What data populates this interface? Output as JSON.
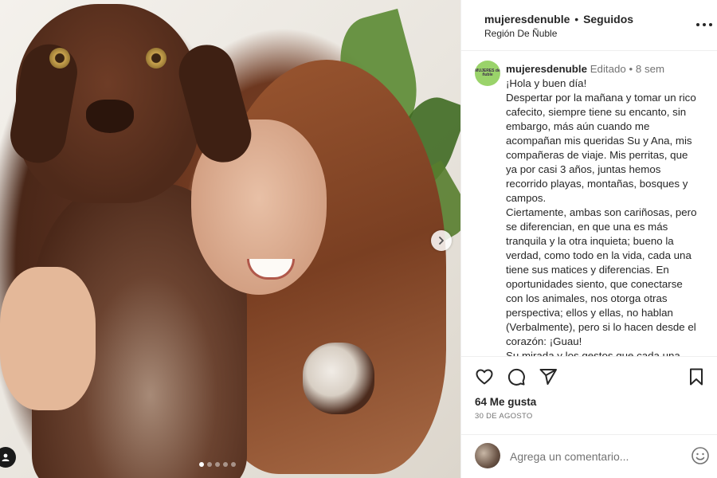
{
  "post": {
    "carousel_dots": 5,
    "carousel_active_index": 0
  },
  "header": {
    "username": "mujeresdenuble",
    "separator": "•",
    "follow_status": "Seguidos",
    "location": "Región De Ñuble"
  },
  "caption": {
    "username": "mujeresdenuble",
    "edited_label": "Editado",
    "meta_separator": "•",
    "time_ago": "8 sem",
    "avatar_text": "MUJERES de ñuble",
    "paragraphs": [
      "¡Hola y buen día!",
      "Despertar por la mañana y tomar un rico cafecito, siempre tiene su encanto, sin embargo, más aún cuando me acompañan mis queridas Su y Ana, mis compañeras de viaje. Mis perritas, que ya por casi 3 años, juntas hemos recorrido playas, montañas, bosques y campos.",
      "Ciertamente, ambas son cariñosas, pero se diferencian, en que una es más tranquila y la otra inquieta; bueno la verdad, como todo en la vida, cada una tiene sus matices y diferencias. En oportunidades siento, que conectarse con los animales, nos otorga otras perspectiva; ellos y ellas, no hablan (Verbalmente), pero si lo hacen desde el corazón: ¡Guau!",
      "Su mirada y los gestos que cada una"
    ]
  },
  "engagement": {
    "likes": "64 Me gusta",
    "date": "30 DE AGOSTO"
  },
  "comment": {
    "placeholder": "Agrega un comentario..."
  },
  "icons": {
    "like": "heart-icon",
    "comment": "comment-icon",
    "share": "send-icon",
    "save": "bookmark-icon",
    "more": "more-options-icon",
    "next": "chevron-right-icon",
    "tagged_user": "user-icon",
    "emoji": "emoji-icon"
  },
  "colors": {
    "text_primary": "#262626",
    "text_secondary": "#737373",
    "divider": "#efefef",
    "avatar_bg": "#9ad36a"
  }
}
